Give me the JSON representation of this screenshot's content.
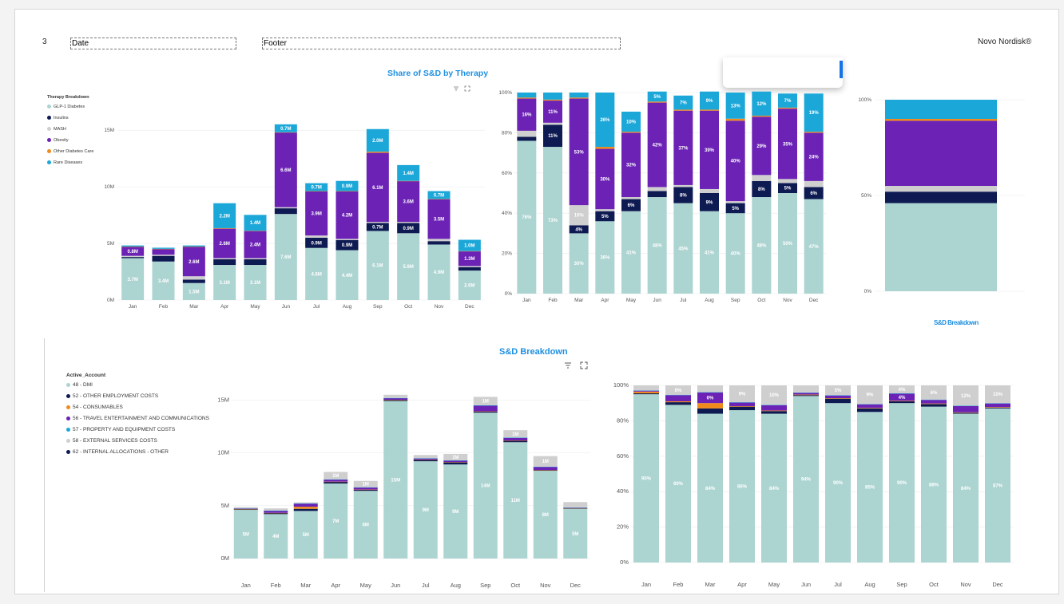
{
  "header": {
    "page_number": "3",
    "date": "Date",
    "footer": "Footer",
    "brand": "Novo Nordisk®"
  },
  "titles": {
    "top": "Share of S&D by Therapy",
    "small_right": "S&D Breakdown",
    "bottom": "S&D Breakdown"
  },
  "months": [
    "Jan",
    "Feb",
    "Mar",
    "Apr",
    "May",
    "Jun",
    "Jul",
    "Aug",
    "Sep",
    "Oct",
    "Nov",
    "Dec"
  ],
  "icons": {
    "filter": "filter-icon",
    "focus": "focus-mode-icon"
  },
  "legend_top": {
    "title": "Therapy Breakdown",
    "items": [
      {
        "name": "GLP-1 Diabetes",
        "color": "#acd4d1"
      },
      {
        "name": "Insulins",
        "color": "#0e1a52"
      },
      {
        "name": "MASH",
        "color": "#cfcfcf"
      },
      {
        "name": "Obesity",
        "color": "#6b22b5"
      },
      {
        "name": "Other Diabetes Care",
        "color": "#f08a1c"
      },
      {
        "name": "Rare Diseases",
        "color": "#1ca7d9"
      }
    ]
  },
  "legend_bottom": {
    "title": "Active_Account",
    "items": [
      {
        "name": "48 - DMI",
        "color": "#acd4d1"
      },
      {
        "name": "52 - OTHER EMPLOYMENT COSTS",
        "color": "#0e1a52"
      },
      {
        "name": "54 - CONSUMABLES",
        "color": "#f08a1c"
      },
      {
        "name": "56 - TRAVEL ENTERTAINMENT AND COMMUNICATIONS",
        "color": "#6b22b5"
      },
      {
        "name": "57 - PROPERTY  AND EQUIPMENT COSTS",
        "color": "#1ca7d9"
      },
      {
        "name": "58 - EXTERNAL SERVICES COSTS",
        "color": "#cfcfcf"
      },
      {
        "name": "62 - INTERNAL ALLOCATIONS - OTHER",
        "color": "#0e1a52"
      }
    ]
  },
  "chart_data": [
    {
      "type": "bar",
      "stacked": true,
      "title": "Share of S&D by Therapy",
      "categories": [
        "Jan",
        "Feb",
        "Mar",
        "Apr",
        "May",
        "Jun",
        "Jul",
        "Aug",
        "Sep",
        "Oct",
        "Nov",
        "Dec"
      ],
      "yticks": [
        "0M",
        "5M",
        "10M",
        "15M"
      ],
      "ylim": [
        0,
        16
      ],
      "series": [
        {
          "name": "GLP-1 Diabetes",
          "color": "#acd4d1",
          "values": [
            3.7,
            3.4,
            1.5,
            3.1,
            3.1,
            7.6,
            4.6,
            4.4,
            6.1,
            5.9,
            4.9,
            2.6
          ],
          "labels": [
            "3.7M",
            "3.4M",
            "1.5M",
            "3.1M",
            "3.1M",
            "7.6M",
            "4.6M",
            "4.4M",
            "6.1M",
            "5.9M",
            "4.9M",
            "2.6M"
          ]
        },
        {
          "name": "Insulins",
          "color": "#0e1a52",
          "values": [
            0.1,
            0.5,
            0.3,
            0.5,
            0.5,
            0.5,
            0.9,
            0.9,
            0.7,
            0.9,
            0.3,
            0.3
          ],
          "labels": [
            "",
            "",
            "",
            "",
            "",
            "",
            "0.9M",
            "0.9M",
            "0.7M",
            "0.9M",
            "",
            ""
          ]
        },
        {
          "name": "MASH",
          "color": "#cfcfcf",
          "values": [
            0.1,
            0.1,
            0.3,
            0.1,
            0.1,
            0.1,
            0.2,
            0.1,
            0.1,
            0.1,
            0.2,
            0.1
          ],
          "labels": [
            "",
            "",
            "",
            "",
            "",
            "",
            "",
            "",
            "",
            "",
            "",
            ""
          ]
        },
        {
          "name": "Obesity",
          "color": "#6b22b5",
          "values": [
            0.8,
            0.5,
            2.6,
            2.6,
            2.4,
            6.6,
            3.9,
            4.2,
            6.1,
            3.6,
            3.5,
            1.3
          ],
          "labels": [
            "0.8M",
            "",
            "2.6M",
            "2.6M",
            "2.4M",
            "6.6M",
            "3.9M",
            "4.2M",
            "6.1M",
            "3.6M",
            "3.5M",
            "1.3M"
          ]
        },
        {
          "name": "Other Diabetes Care",
          "color": "#f08a1c",
          "values": [
            0.02,
            0.02,
            0.02,
            0.05,
            0.02,
            0.02,
            0.02,
            0.02,
            0.1,
            0.02,
            0.02,
            0.02
          ],
          "labels": [
            "",
            "",
            "",
            "",
            "",
            "",
            "",
            "",
            "",
            "",
            "",
            ""
          ]
        },
        {
          "name": "Rare Diseases",
          "color": "#1ca7d9",
          "values": [
            0.1,
            0.1,
            0.1,
            2.2,
            1.4,
            0.7,
            0.7,
            0.9,
            2.0,
            1.4,
            0.7,
            1.0
          ],
          "labels": [
            "",
            "",
            "",
            "2.2M",
            "1.4M",
            "0.7M",
            "0.7M",
            "0.9M",
            "2.0M",
            "1.4M",
            "0.7M",
            "1.0M"
          ]
        }
      ]
    },
    {
      "type": "bar",
      "stacked": true,
      "percent": true,
      "categories": [
        "Jan",
        "Feb",
        "Mar",
        "Apr",
        "May",
        "Jun",
        "Jul",
        "Aug",
        "Sep",
        "Oct",
        "Nov",
        "Dec"
      ],
      "yticks": [
        "0%",
        "20%",
        "40%",
        "60%",
        "80%",
        "100%"
      ],
      "ylim": [
        0,
        100
      ],
      "series": [
        {
          "name": "GLP-1 Diabetes",
          "color": "#acd4d1",
          "values": [
            76,
            73,
            30,
            36,
            41,
            48,
            45,
            41,
            40,
            48,
            50,
            47
          ],
          "labels": [
            "76%",
            "73%",
            "30%",
            "36%",
            "41%",
            "48%",
            "45%",
            "41%",
            "40%",
            "48%",
            "50%",
            "47%"
          ]
        },
        {
          "name": "Insulins",
          "color": "#0e1a52",
          "values": [
            2,
            11,
            4,
            5,
            6,
            3,
            8,
            9,
            5,
            8,
            5,
            6
          ],
          "labels": [
            "",
            "11%",
            "4%",
            "5%",
            "6%",
            "",
            "8%",
            "9%",
            "5%",
            "8%",
            "5%",
            "6%"
          ]
        },
        {
          "name": "MASH",
          "color": "#cfcfcf",
          "values": [
            3,
            1,
            10,
            1,
            1,
            2,
            1,
            2,
            1,
            3,
            2,
            3
          ],
          "labels": [
            "",
            "",
            "10%",
            "",
            "",
            "",
            "",
            "",
            "",
            "",
            "",
            ""
          ]
        },
        {
          "name": "Obesity",
          "color": "#6b22b5",
          "values": [
            16,
            11,
            53,
            30,
            32,
            42,
            37,
            39,
            40,
            29,
            35,
            24
          ],
          "labels": [
            "16%",
            "11%",
            "53%",
            "30%",
            "32%",
            "42%",
            "37%",
            "39%",
            "40%",
            "29%",
            "35%",
            "24%"
          ]
        },
        {
          "name": "Other Diabetes Care",
          "color": "#f08a1c",
          "values": [
            0.5,
            0.5,
            0.5,
            1,
            0.5,
            0.5,
            0.5,
            0.5,
            1,
            0.5,
            0.5,
            0.5
          ],
          "labels": [
            "",
            "",
            "",
            "",
            "",
            "",
            "",
            "",
            "",
            "",
            "",
            ""
          ]
        },
        {
          "name": "Rare Diseases",
          "color": "#1ca7d9",
          "values": [
            2.5,
            3.5,
            2.5,
            27,
            10,
            5,
            7,
            9,
            13,
            12,
            7,
            19
          ],
          "labels": [
            "",
            "",
            "",
            "26%",
            "10%",
            "5%",
            "7%",
            "9%",
            "13%",
            "12%",
            "7%",
            "19%"
          ]
        }
      ]
    },
    {
      "type": "bar",
      "stacked": true,
      "percent": true,
      "categories": [
        "",
        ""
      ],
      "yticks": [
        "0%",
        "50%",
        "100%"
      ],
      "ylim": [
        0,
        100
      ],
      "series": [
        {
          "name": "GLP-1 Diabetes",
          "color": "#acd4d1",
          "values": [
            46,
            46
          ]
        },
        {
          "name": "Insulins",
          "color": "#0e1a52",
          "values": [
            6,
            6
          ]
        },
        {
          "name": "MASH",
          "color": "#cfcfcf",
          "values": [
            3,
            3
          ]
        },
        {
          "name": "Obesity",
          "color": "#6b22b5",
          "values": [
            34,
            34
          ]
        },
        {
          "name": "Other Diabetes Care",
          "color": "#f08a1c",
          "values": [
            1,
            1
          ]
        },
        {
          "name": "Rare Diseases",
          "color": "#1ca7d9",
          "values": [
            10,
            10
          ]
        }
      ]
    },
    {
      "type": "bar",
      "stacked": true,
      "title": "S&D Breakdown",
      "categories": [
        "Jan",
        "Feb",
        "Mar",
        "Apr",
        "May",
        "Jun",
        "Jul",
        "Aug",
        "Sep",
        "Oct",
        "Nov",
        "Dec"
      ],
      "yticks": [
        "0M",
        "5M",
        "10M",
        "15M"
      ],
      "ylim": [
        0,
        16
      ],
      "series": [
        {
          "name": "48 - DMI",
          "color": "#acd4d1",
          "values": [
            4.6,
            4.2,
            4.5,
            7.1,
            6.4,
            14.9,
            9.2,
            8.9,
            13.8,
            11.0,
            8.3,
            4.7
          ],
          "labels": [
            "5M",
            "4M",
            "5M",
            "7M",
            "6M",
            "15M",
            "9M",
            "9M",
            "14M",
            "11M",
            "8M",
            "5M"
          ]
        },
        {
          "name": "52 - OTHER EMPLOYMENT COSTS",
          "color": "#0e1a52",
          "values": [
            0.05,
            0.1,
            0.2,
            0.15,
            0.1,
            0.1,
            0.15,
            0.2,
            0.1,
            0.15,
            0.05,
            0.05
          ],
          "labels": [
            "",
            "",
            "",
            "",
            "",
            "",
            "",
            "",
            "",
            "",
            "",
            ""
          ]
        },
        {
          "name": "54 - CONSUMABLES",
          "color": "#f08a1c",
          "values": [
            0.05,
            0.02,
            0.2,
            0.02,
            0.02,
            0.02,
            0.02,
            0.02,
            0.02,
            0.02,
            0.02,
            0.02
          ],
          "labels": [
            "",
            "",
            "",
            "",
            "",
            "",
            "",
            "",
            "",
            "",
            "",
            ""
          ]
        },
        {
          "name": "56 - TRAVEL ENTERTAINMENT AND COMMUNICATIONS",
          "color": "#6b22b5",
          "values": [
            0.05,
            0.2,
            0.3,
            0.2,
            0.2,
            0.15,
            0.1,
            0.15,
            0.55,
            0.25,
            0.3,
            0.05
          ],
          "labels": [
            "",
            "",
            "",
            "",
            "",
            "",
            "",
            "",
            "",
            "",
            "",
            ""
          ]
        },
        {
          "name": "57 - PROPERTY  AND EQUIPMENT COSTS",
          "color": "#1ca7d9",
          "values": [
            0.02,
            0.02,
            0.02,
            0.02,
            0.02,
            0.02,
            0.02,
            0.02,
            0.02,
            0.02,
            0.02,
            0.02
          ],
          "labels": [
            "",
            "",
            "",
            "",
            "",
            "",
            "",
            "",
            "",
            "",
            "",
            ""
          ]
        },
        {
          "name": "58 - EXTERNAL SERVICES COSTS",
          "color": "#cfcfcf",
          "values": [
            0.1,
            0.2,
            0.1,
            0.7,
            0.6,
            0.3,
            0.3,
            0.6,
            0.8,
            0.7,
            1.0,
            0.5
          ],
          "labels": [
            "",
            "",
            "",
            "1M",
            "1M",
            "",
            "",
            "1M",
            "1M",
            "1M",
            "1M",
            ""
          ]
        }
      ]
    },
    {
      "type": "bar",
      "stacked": true,
      "percent": true,
      "categories": [
        "Jan",
        "Feb",
        "Mar",
        "Apr",
        "May",
        "Jun",
        "Jul",
        "Aug",
        "Sep",
        "Oct",
        "Nov",
        "Dec"
      ],
      "yticks": [
        "0%",
        "20%",
        "40%",
        "60%",
        "80%",
        "100%"
      ],
      "ylim": [
        0,
        100
      ],
      "series": [
        {
          "name": "48 - DMI",
          "color": "#acd4d1",
          "values": [
            95,
            89,
            84,
            86,
            84,
            94,
            90,
            85,
            90,
            88,
            84,
            87
          ],
          "labels": [
            "95%",
            "89%",
            "84%",
            "86%",
            "84%",
            "94%",
            "90%",
            "85%",
            "90%",
            "88%",
            "84%",
            "87%"
          ]
        },
        {
          "name": "52 - OTHER EMPLOYMENT COSTS",
          "color": "#0e1a52",
          "values": [
            0.5,
            1.5,
            3,
            2,
            1.5,
            0.5,
            2.5,
            2,
            1,
            1.5,
            0.5,
            0.5
          ],
          "labels": [
            "",
            "",
            "",
            "",
            "",
            "",
            "",
            "",
            "",
            "",
            "",
            ""
          ]
        },
        {
          "name": "54 - CONSUMABLES",
          "color": "#f08a1c",
          "values": [
            1,
            0.5,
            3,
            0.3,
            0.3,
            0.3,
            0.3,
            0.3,
            0.3,
            0.3,
            0.3,
            0.3
          ],
          "labels": [
            "",
            "",
            "",
            "",
            "",
            "",
            "",
            "",
            "",
            "",
            "",
            ""
          ]
        },
        {
          "name": "56 - TRAVEL ENTERTAINMENT AND COMMUNICATIONS",
          "color": "#6b22b5",
          "values": [
            0.5,
            3.5,
            6,
            2,
            3,
            1,
            1.5,
            2,
            4,
            2,
            3.5,
            2
          ],
          "labels": [
            "",
            "",
            "6%",
            "",
            "",
            "",
            "",
            "",
            "4%",
            "",
            "",
            ""
          ]
        },
        {
          "name": "57 - PROPERTY  AND EQUIPMENT COSTS",
          "color": "#1ca7d9",
          "values": [
            0.2,
            0.2,
            0.2,
            0.2,
            0.2,
            0.2,
            0.2,
            0.2,
            0.2,
            0.2,
            0.2,
            0.2
          ],
          "labels": [
            "",
            "",
            "",
            "",
            "",
            "",
            "",
            "",
            "",
            "",
            "",
            ""
          ]
        },
        {
          "name": "58 - EXTERNAL SERVICES COSTS",
          "color": "#cfcfcf",
          "values": [
            2.8,
            5.3,
            3.8,
            9.5,
            11,
            4,
            5.5,
            10.5,
            4.5,
            8,
            11.5,
            10
          ],
          "labels": [
            "",
            "6%",
            "",
            "9%",
            "10%",
            "",
            "5%",
            "9%",
            "4%",
            "6%",
            "12%",
            "10%"
          ]
        }
      ]
    }
  ]
}
